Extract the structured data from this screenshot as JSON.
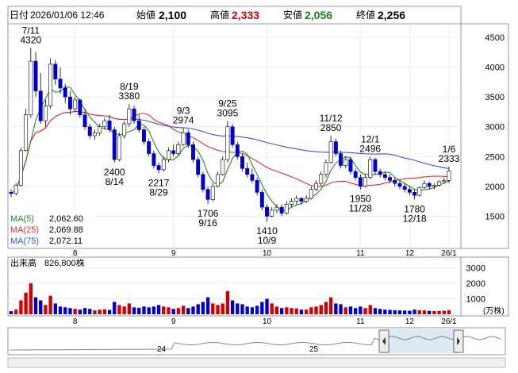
{
  "header": {
    "date_label": "日付",
    "date_value": "2026/01/06 12:46",
    "open_label": "始値",
    "open_value": "2,100",
    "high_label": "高値",
    "high_value": "2,333",
    "low_label": "安値",
    "low_value": "2,056",
    "close_label": "終値",
    "close_value": "2,256"
  },
  "legend": {
    "ma5": "MA(5)",
    "ma5_value": "2,062.60",
    "ma25": "MA(25)",
    "ma25_value": "2,069.88",
    "ma75": "MA(75)",
    "ma75_value": "2,072.11"
  },
  "volume_header": {
    "label": "出来高",
    "value": "826,800株"
  },
  "volume_unit": "(万株)",
  "navigator_labels": [
    "24",
    "25"
  ],
  "colors": {
    "up": "#d00000",
    "down": "#0000cc",
    "ma5": "#228b22",
    "ma25": "#e03030",
    "ma75": "#3355ee",
    "high": "#d00000",
    "low": "#1a7f1a"
  },
  "chart_data": {
    "type": "candlestick",
    "price_axis": {
      "ticks": [
        1500,
        2000,
        2500,
        3000,
        3500,
        4000,
        4500
      ],
      "range": [
        1000,
        4700
      ]
    },
    "volume_axis": {
      "ticks": [
        1000,
        2000,
        3000
      ],
      "range": [
        0,
        3600
      ]
    },
    "x_ticks": [
      "8",
      "9",
      "10",
      "11",
      "12",
      "26/1"
    ],
    "annotations": [
      {
        "date": "7/11",
        "price": "4320",
        "pos": "above"
      },
      {
        "date": "8/19",
        "price": "3380",
        "pos": "above"
      },
      {
        "date": "8/14",
        "price": "2400",
        "pos": "below"
      },
      {
        "date": "9/3",
        "price": "2974",
        "pos": "above"
      },
      {
        "date": "8/29",
        "price": "2217",
        "pos": "below"
      },
      {
        "date": "9/25",
        "price": "3095",
        "pos": "above"
      },
      {
        "date": "9/16",
        "price": "1706",
        "pos": "below"
      },
      {
        "date": "10/9",
        "price": "1410",
        "pos": "below"
      },
      {
        "date": "11/12",
        "price": "2850",
        "pos": "above"
      },
      {
        "date": "12/1",
        "price": "2496",
        "pos": "above"
      },
      {
        "date": "11/28",
        "price": "1950",
        "pos": "below"
      },
      {
        "date": "12/18",
        "price": "1780",
        "pos": "below"
      },
      {
        "date": "1/6",
        "price": "2333",
        "pos": "above"
      }
    ],
    "candles": [
      [
        1900,
        1950,
        1820,
        1880,
        200
      ],
      [
        1880,
        2050,
        1850,
        2020,
        300
      ],
      [
        2020,
        2650,
        2000,
        2600,
        900
      ],
      [
        2600,
        3300,
        2580,
        3200,
        1400
      ],
      [
        3200,
        4320,
        3150,
        4100,
        2000
      ],
      [
        4100,
        4250,
        3500,
        3600,
        1100
      ],
      [
        3600,
        3900,
        3050,
        3100,
        900
      ],
      [
        3100,
        3450,
        3000,
        3350,
        600
      ],
      [
        3350,
        4150,
        3300,
        4050,
        1200
      ],
      [
        4050,
        4120,
        3700,
        3800,
        700
      ],
      [
        3800,
        4000,
        3550,
        3650,
        500
      ],
      [
        3650,
        3720,
        3400,
        3500,
        450
      ],
      [
        3500,
        3600,
        3200,
        3300,
        400
      ],
      [
        3300,
        3500,
        3250,
        3450,
        350
      ],
      [
        3450,
        3480,
        3150,
        3200,
        300
      ],
      [
        3200,
        3300,
        2950,
        3000,
        400
      ],
      [
        3000,
        3050,
        2800,
        2850,
        350
      ],
      [
        2850,
        2950,
        2780,
        2900,
        250
      ],
      [
        2900,
        3050,
        2850,
        3000,
        300
      ],
      [
        3000,
        3150,
        2950,
        3100,
        320
      ],
      [
        3100,
        3200,
        2900,
        2950,
        280
      ],
      [
        2950,
        3000,
        2400,
        2450,
        800
      ],
      [
        2450,
        2900,
        2420,
        2850,
        600
      ],
      [
        2850,
        3100,
        2800,
        3050,
        500
      ],
      [
        3050,
        3380,
        3000,
        3300,
        700
      ],
      [
        3300,
        3350,
        3050,
        3100,
        450
      ],
      [
        3100,
        3200,
        2900,
        2950,
        420
      ],
      [
        2950,
        3000,
        2700,
        2750,
        500
      ],
      [
        2750,
        2800,
        2500,
        2550,
        450
      ],
      [
        2550,
        2600,
        2300,
        2350,
        500
      ],
      [
        2350,
        2400,
        2217,
        2280,
        600
      ],
      [
        2280,
        2500,
        2250,
        2450,
        500
      ],
      [
        2450,
        2650,
        2400,
        2600,
        450
      ],
      [
        2600,
        2700,
        2500,
        2550,
        350
      ],
      [
        2550,
        2750,
        2520,
        2700,
        400
      ],
      [
        2700,
        2974,
        2680,
        2900,
        550
      ],
      [
        2900,
        2950,
        2650,
        2700,
        400
      ],
      [
        2700,
        2750,
        2400,
        2450,
        500
      ],
      [
        2450,
        2500,
        2150,
        2200,
        650
      ],
      [
        2200,
        2250,
        1900,
        1950,
        800
      ],
      [
        1950,
        2000,
        1706,
        1780,
        1100
      ],
      [
        1780,
        2050,
        1750,
        2000,
        700
      ],
      [
        2000,
        2250,
        1980,
        2200,
        600
      ],
      [
        2200,
        2500,
        2180,
        2450,
        700
      ],
      [
        2450,
        3095,
        2400,
        3000,
        1500
      ],
      [
        3000,
        3050,
        2650,
        2700,
        900
      ],
      [
        2700,
        2750,
        2450,
        2500,
        700
      ],
      [
        2500,
        2550,
        2250,
        2300,
        650
      ],
      [
        2300,
        2400,
        2150,
        2200,
        500
      ],
      [
        2200,
        2300,
        2050,
        2100,
        450
      ],
      [
        2100,
        2150,
        1850,
        1900,
        550
      ],
      [
        1900,
        1950,
        1600,
        1650,
        800
      ],
      [
        1650,
        1700,
        1410,
        1500,
        1000
      ],
      [
        1500,
        1650,
        1480,
        1600,
        700
      ],
      [
        1600,
        1700,
        1550,
        1650,
        500
      ],
      [
        1650,
        1700,
        1500,
        1550,
        400
      ],
      [
        1550,
        1750,
        1530,
        1700,
        450
      ],
      [
        1700,
        1800,
        1650,
        1750,
        400
      ],
      [
        1750,
        1850,
        1700,
        1800,
        380
      ],
      [
        1800,
        1820,
        1700,
        1750,
        300
      ],
      [
        1750,
        1850,
        1720,
        1800,
        300
      ],
      [
        1800,
        2000,
        1780,
        1950,
        450
      ],
      [
        1950,
        2100,
        1920,
        2050,
        500
      ],
      [
        2050,
        2250,
        2000,
        2200,
        600
      ],
      [
        2200,
        2450,
        2150,
        2400,
        800
      ],
      [
        2400,
        2850,
        2380,
        2750,
        1100
      ],
      [
        2750,
        2800,
        2500,
        2550,
        700
      ],
      [
        2550,
        2600,
        2300,
        2350,
        650
      ],
      [
        2350,
        2500,
        2300,
        2450,
        450
      ],
      [
        2450,
        2500,
        2200,
        2250,
        500
      ],
      [
        2250,
        2300,
        2100,
        2150,
        400
      ],
      [
        2150,
        2200,
        1950,
        2000,
        500
      ],
      [
        2000,
        2200,
        1980,
        2150,
        400
      ],
      [
        2150,
        2496,
        2120,
        2450,
        600
      ],
      [
        2450,
        2480,
        2200,
        2250,
        400
      ],
      [
        2250,
        2300,
        2150,
        2200,
        350
      ],
      [
        2200,
        2250,
        2100,
        2150,
        300
      ],
      [
        2150,
        2200,
        2050,
        2100,
        280
      ],
      [
        2100,
        2150,
        2000,
        2050,
        260
      ],
      [
        2050,
        2100,
        1950,
        2000,
        250
      ],
      [
        2000,
        2050,
        1900,
        1950,
        240
      ],
      [
        1950,
        2000,
        1850,
        1900,
        230
      ],
      [
        1900,
        1950,
        1780,
        1850,
        300
      ],
      [
        1850,
        2000,
        1830,
        1980,
        260
      ],
      [
        1980,
        2100,
        1960,
        2050,
        250
      ],
      [
        2050,
        2080,
        1950,
        2000,
        220
      ],
      [
        2000,
        2050,
        1950,
        2020,
        210
      ],
      [
        2020,
        2100,
        2000,
        2080,
        220
      ],
      [
        2080,
        2150,
        2050,
        2100,
        230
      ],
      [
        2100,
        2333,
        2056,
        2256,
        260
      ]
    ]
  }
}
